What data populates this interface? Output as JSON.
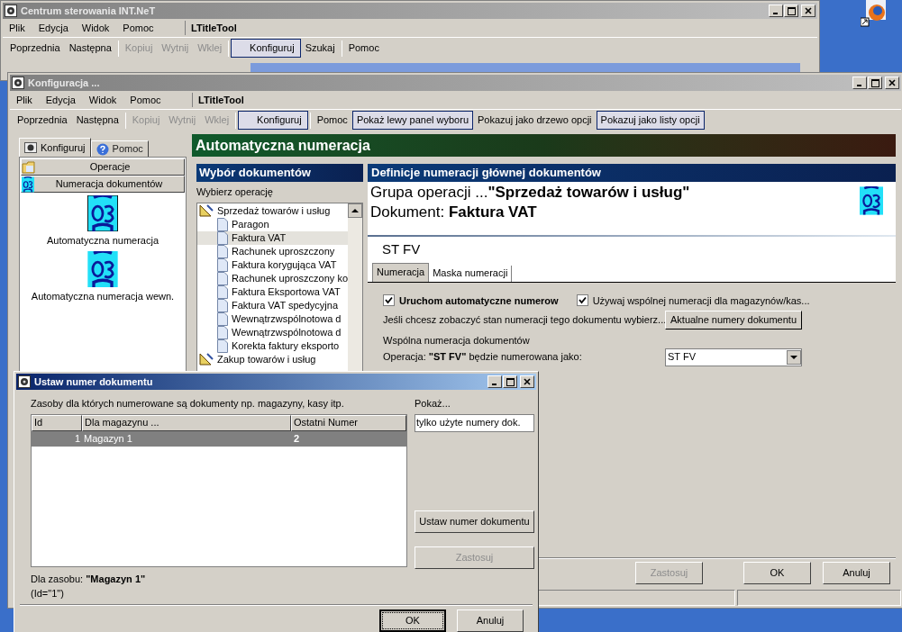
{
  "main_window": {
    "title": "Centrum sterowania INT.NeT",
    "active": false,
    "menu": [
      "Plik",
      "Edycja",
      "Widok",
      "Pomoc"
    ],
    "tool_title": "LTitleTool",
    "toolbar": [
      [
        {
          "label": "Poprzednia",
          "disabled": false,
          "pressed": false
        },
        {
          "label": "Następna",
          "disabled": false,
          "pressed": false
        }
      ],
      [
        {
          "label": "Kopiuj",
          "disabled": true,
          "pressed": false
        },
        {
          "label": "Wytnij",
          "disabled": true,
          "pressed": false
        },
        {
          "label": "Wklej",
          "disabled": true,
          "pressed": false
        }
      ],
      [
        {
          "label": "Konfiguruj",
          "disabled": false,
          "pressed": true
        },
        {
          "label": "Szukaj",
          "disabled": false,
          "pressed": false
        }
      ],
      [
        {
          "label": "Pomoc",
          "disabled": false,
          "pressed": false
        }
      ]
    ]
  },
  "config_window": {
    "title": "Konfiguracja ...",
    "active": false,
    "menu": [
      "Plik",
      "Edycja",
      "Widok",
      "Pomoc"
    ],
    "tool_title": "LTitleTool",
    "toolbar": [
      [
        {
          "label": "Poprzednia",
          "disabled": false,
          "pressed": false
        },
        {
          "label": "Następna",
          "disabled": false,
          "pressed": false
        }
      ],
      [
        {
          "label": "Kopiuj",
          "disabled": true,
          "pressed": false
        },
        {
          "label": "Wytnij",
          "disabled": true,
          "pressed": false
        },
        {
          "label": "Wklej",
          "disabled": true,
          "pressed": false
        }
      ],
      [
        {
          "label": "Konfiguruj",
          "disabled": false,
          "pressed": true
        }
      ],
      [
        {
          "label": "Pomoc",
          "disabled": false,
          "pressed": false
        },
        {
          "label": "Pokaż lewy panel wyboru",
          "disabled": false,
          "pressed": true
        },
        {
          "label": "Pokazuj jako drzewo opcji",
          "disabled": false,
          "pressed": false
        },
        {
          "label": "Pokazuj jako listy opcji",
          "disabled": false,
          "pressed": true
        }
      ]
    ],
    "left_panel": {
      "tabs": [
        {
          "label": "Konfiguruj",
          "selected": true
        },
        {
          "label": "Pomoc",
          "selected": false
        }
      ],
      "sections": [
        {
          "label": "Operacje",
          "kind": "operations"
        },
        {
          "label": "Numeracja dokumentów",
          "kind": "numbering"
        }
      ],
      "items": [
        {
          "label": "Automatyczna numeracja",
          "selected": true
        },
        {
          "label": "Automatyczna numeracja wewn.",
          "selected": false
        }
      ]
    },
    "header": "Automatyczna numeracja",
    "documents": {
      "title": "Wybór dokumentów",
      "label": "Wybierz operację",
      "tree": [
        {
          "label": "Sprzedaż towarów i usług",
          "selected": false,
          "children": [
            {
              "label": "Paragon",
              "selected": false
            },
            {
              "label": "Faktura VAT",
              "selected": true
            },
            {
              "label": "Rachunek uproszczony",
              "selected": false
            },
            {
              "label": "Faktura korygująca VAT",
              "selected": false
            },
            {
              "label": "Rachunek uproszczony ko",
              "selected": false
            },
            {
              "label": "Faktura Eksportowa VAT",
              "selected": false
            },
            {
              "label": "Faktura VAT spedycyjna",
              "selected": false
            },
            {
              "label": "Wewnątrzwspólnotowa d",
              "selected": false
            },
            {
              "label": "Wewnątrzwspólnotowa d",
              "selected": false
            },
            {
              "label": "Korekta faktury eksporto",
              "selected": false
            }
          ]
        },
        {
          "label": "Zakup towarów i usług",
          "selected": false
        }
      ]
    },
    "definition": {
      "title": "Definicje numeracji głównej dokumentów",
      "group_line": "Grupa operacji ...**\"Sprzedaż towarów i usług\"**",
      "document_line": "Dokument: **Faktura VAT**",
      "code": "ST FV",
      "tabs": [
        {
          "label": "Numeracja",
          "selected": true
        },
        {
          "label": "Maska numeracji",
          "selected": false
        }
      ],
      "options": [
        {
          "label": "Uruchom automatyczne numerow",
          "checked": true,
          "bold": true
        },
        {
          "label": "Używaj wspólnej numeracji dla magazynów/kas...",
          "checked": true,
          "bold": false
        }
      ],
      "hint": "Jeśli chcesz zobaczyć stan numeracji tego dokumentu wybierz...",
      "hint_button": "Aktualne numery dokumentu",
      "common_label": "Wspólna numeracja dokumentów",
      "operation_line": "Operacja: **\"ST FV\"** będzie numerowana jako:",
      "select_value": "ST FV"
    },
    "buttons": [
      {
        "label": "Zastosuj",
        "disabled": true
      },
      {
        "label": "OK",
        "disabled": false
      },
      {
        "label": "Anuluj",
        "disabled": false
      }
    ]
  },
  "dialog": {
    "title": "Ustaw numer dokumentu",
    "active": true,
    "caption": "Zasoby dla których numerowane są dokumenty np. magazyny, kasy itp.",
    "table": {
      "columns": [
        "Id",
        "Dla magazynu ...",
        "Ostatni Numer"
      ],
      "rows": [
        {
          "cells": [
            "1",
            "Magazyn 1",
            "2"
          ],
          "selected": true
        }
      ]
    },
    "show_label": "Pokaż...",
    "show_value": "tylko użyte numery dok.",
    "side_buttons": [
      {
        "label": "Ustaw numer dokumentu",
        "disabled": false
      },
      {
        "label": "Zastosuj",
        "disabled": true
      }
    ],
    "resource_line": "Dla zasobu: **\"Magazyn 1\"**",
    "id_line": "(Id=\"1\")",
    "buttons": [
      {
        "label": "OK",
        "default": true
      },
      {
        "label": "Anuluj",
        "default": false
      }
    ]
  }
}
